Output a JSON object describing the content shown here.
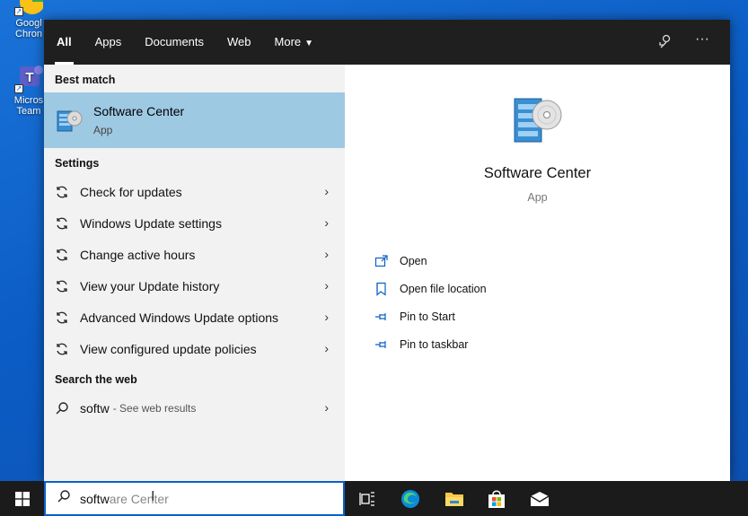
{
  "desktop": {
    "icons": [
      {
        "label_line1": "Googl",
        "label_line2": "Chron"
      },
      {
        "label_line1": "Micros",
        "label_line2": "Team"
      }
    ]
  },
  "flyout": {
    "tabs": [
      {
        "label": "All",
        "active": true
      },
      {
        "label": "Apps"
      },
      {
        "label": "Documents"
      },
      {
        "label": "Web"
      },
      {
        "label": "More"
      }
    ],
    "best_match": {
      "heading": "Best match",
      "title": "Software Center",
      "subtitle": "App"
    },
    "settings": {
      "heading": "Settings",
      "items": [
        {
          "label": "Check for updates"
        },
        {
          "label": "Windows Update settings"
        },
        {
          "label": "Change active hours"
        },
        {
          "label": "View your Update history"
        },
        {
          "label": "Advanced Windows Update options"
        },
        {
          "label": "View configured update policies"
        }
      ]
    },
    "web": {
      "heading": "Search the web",
      "query": "softw",
      "suffix": "- See web results"
    },
    "detail": {
      "title": "Software Center",
      "subtitle": "App",
      "actions": [
        {
          "label": "Open",
          "icon": "open-icon"
        },
        {
          "label": "Open file location",
          "icon": "file-location-icon"
        },
        {
          "label": "Pin to Start",
          "icon": "pin-icon"
        },
        {
          "label": "Pin to taskbar",
          "icon": "pin-icon"
        }
      ]
    }
  },
  "taskbar": {
    "search_typed": "softw",
    "search_ghost": "are Center",
    "icons": [
      "windows-start-icon",
      "task-view-icon",
      "edge-icon",
      "file-explorer-icon",
      "store-icon",
      "mail-icon"
    ]
  },
  "colors": {
    "desktop_bg": "#0b5cc4",
    "flyout_topbar": "#1f1f1f",
    "selected_row": "#9ec9e3",
    "accent": "#0a62c7",
    "taskbar": "#1b1b1b"
  }
}
